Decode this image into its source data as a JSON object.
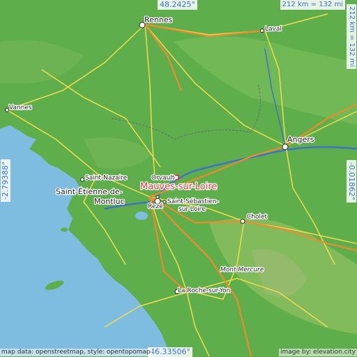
{
  "map": {
    "highlight_place": "Mauves-sur-Loire",
    "highlight_color": "#e8343c",
    "coordinates": {
      "top": "48.2425°",
      "bottom": "46.33506°",
      "left": "-2.79388°",
      "right": "-0.01862°"
    },
    "scale": {
      "horizontal": "212 km = 132 mi",
      "vertical": "212 km = 132 mi"
    },
    "credits": {
      "left": "map data: openstreetmap, style: opentopomap",
      "right": "image by: elevation.city"
    },
    "places": {
      "rennes": "Rennes",
      "laval": "Laval",
      "vannes": "Vannes",
      "angers": "Angers",
      "saint_nazaire": "Saint-Nazaire",
      "saint_etienne_1": "Saint-Étienne-de-",
      "saint_etienne_2": "Montluc",
      "orvault": "Orvault",
      "reze": "Rezé",
      "saint_sebastien_1": "Saint-Sébastien-",
      "saint_sebastien_2": "sur-Loire",
      "cholet": "Cholet",
      "mont_mercure": "Mont Mercure",
      "la_roche": "La Roche-sur-Yon"
    },
    "colors": {
      "land": "#5fae4c",
      "sea": "#7ebde0",
      "motorway": "#f08a2c",
      "main_road": "#f2dc4a",
      "river": "#3f72c8"
    }
  }
}
